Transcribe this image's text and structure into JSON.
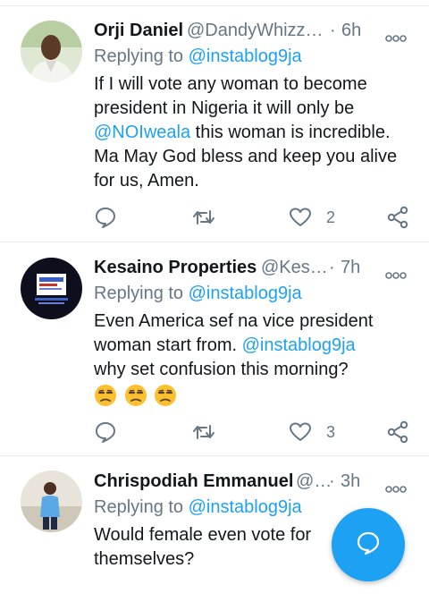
{
  "tweets": [
    {
      "name": "Orji Daniel",
      "handle": "@DandyWhizz…",
      "time": "6h",
      "replying_prefix": "Replying to",
      "replying_to": "@instablog9ja",
      "body_lines": [
        "If I will vote any woman to become",
        "president in Nigeria it will only be"
      ],
      "body_mention": "@NOIweala",
      "body_after_mention": " this woman is incredible.",
      "body_rest": [
        "Ma May God bless and keep you alive",
        "for us, Amen."
      ],
      "likes": "2"
    },
    {
      "name": "Kesaino Properties",
      "handle": "@Kes…",
      "time": "7h",
      "replying_prefix": "Replying to",
      "replying_to": "@instablog9ja",
      "body_line1": "Even America sef na vice president",
      "body_line2_before": "woman start from. ",
      "body_mention": "@instablog9ja",
      "body_line3": "why set confusion this morning?",
      "emoji_count": 3,
      "likes": "3"
    },
    {
      "name": "Chrispodiah Emmanuel",
      "handle": "@…",
      "time": "3h",
      "replying_prefix": "Replying to",
      "replying_to": "@instablog9ja",
      "body_lines": [
        "Would female even vote for",
        "themselves?"
      ]
    }
  ],
  "separator": "·",
  "colors": {
    "accent": "#1da1f2",
    "secondary_text": "#657786",
    "primary_text": "#14171a",
    "divider": "#e6ecf0"
  },
  "icons": [
    "reply-icon",
    "retweet-icon",
    "like-icon",
    "share-icon",
    "more-icon",
    "compose-icon",
    "unamused-face-emoji"
  ]
}
